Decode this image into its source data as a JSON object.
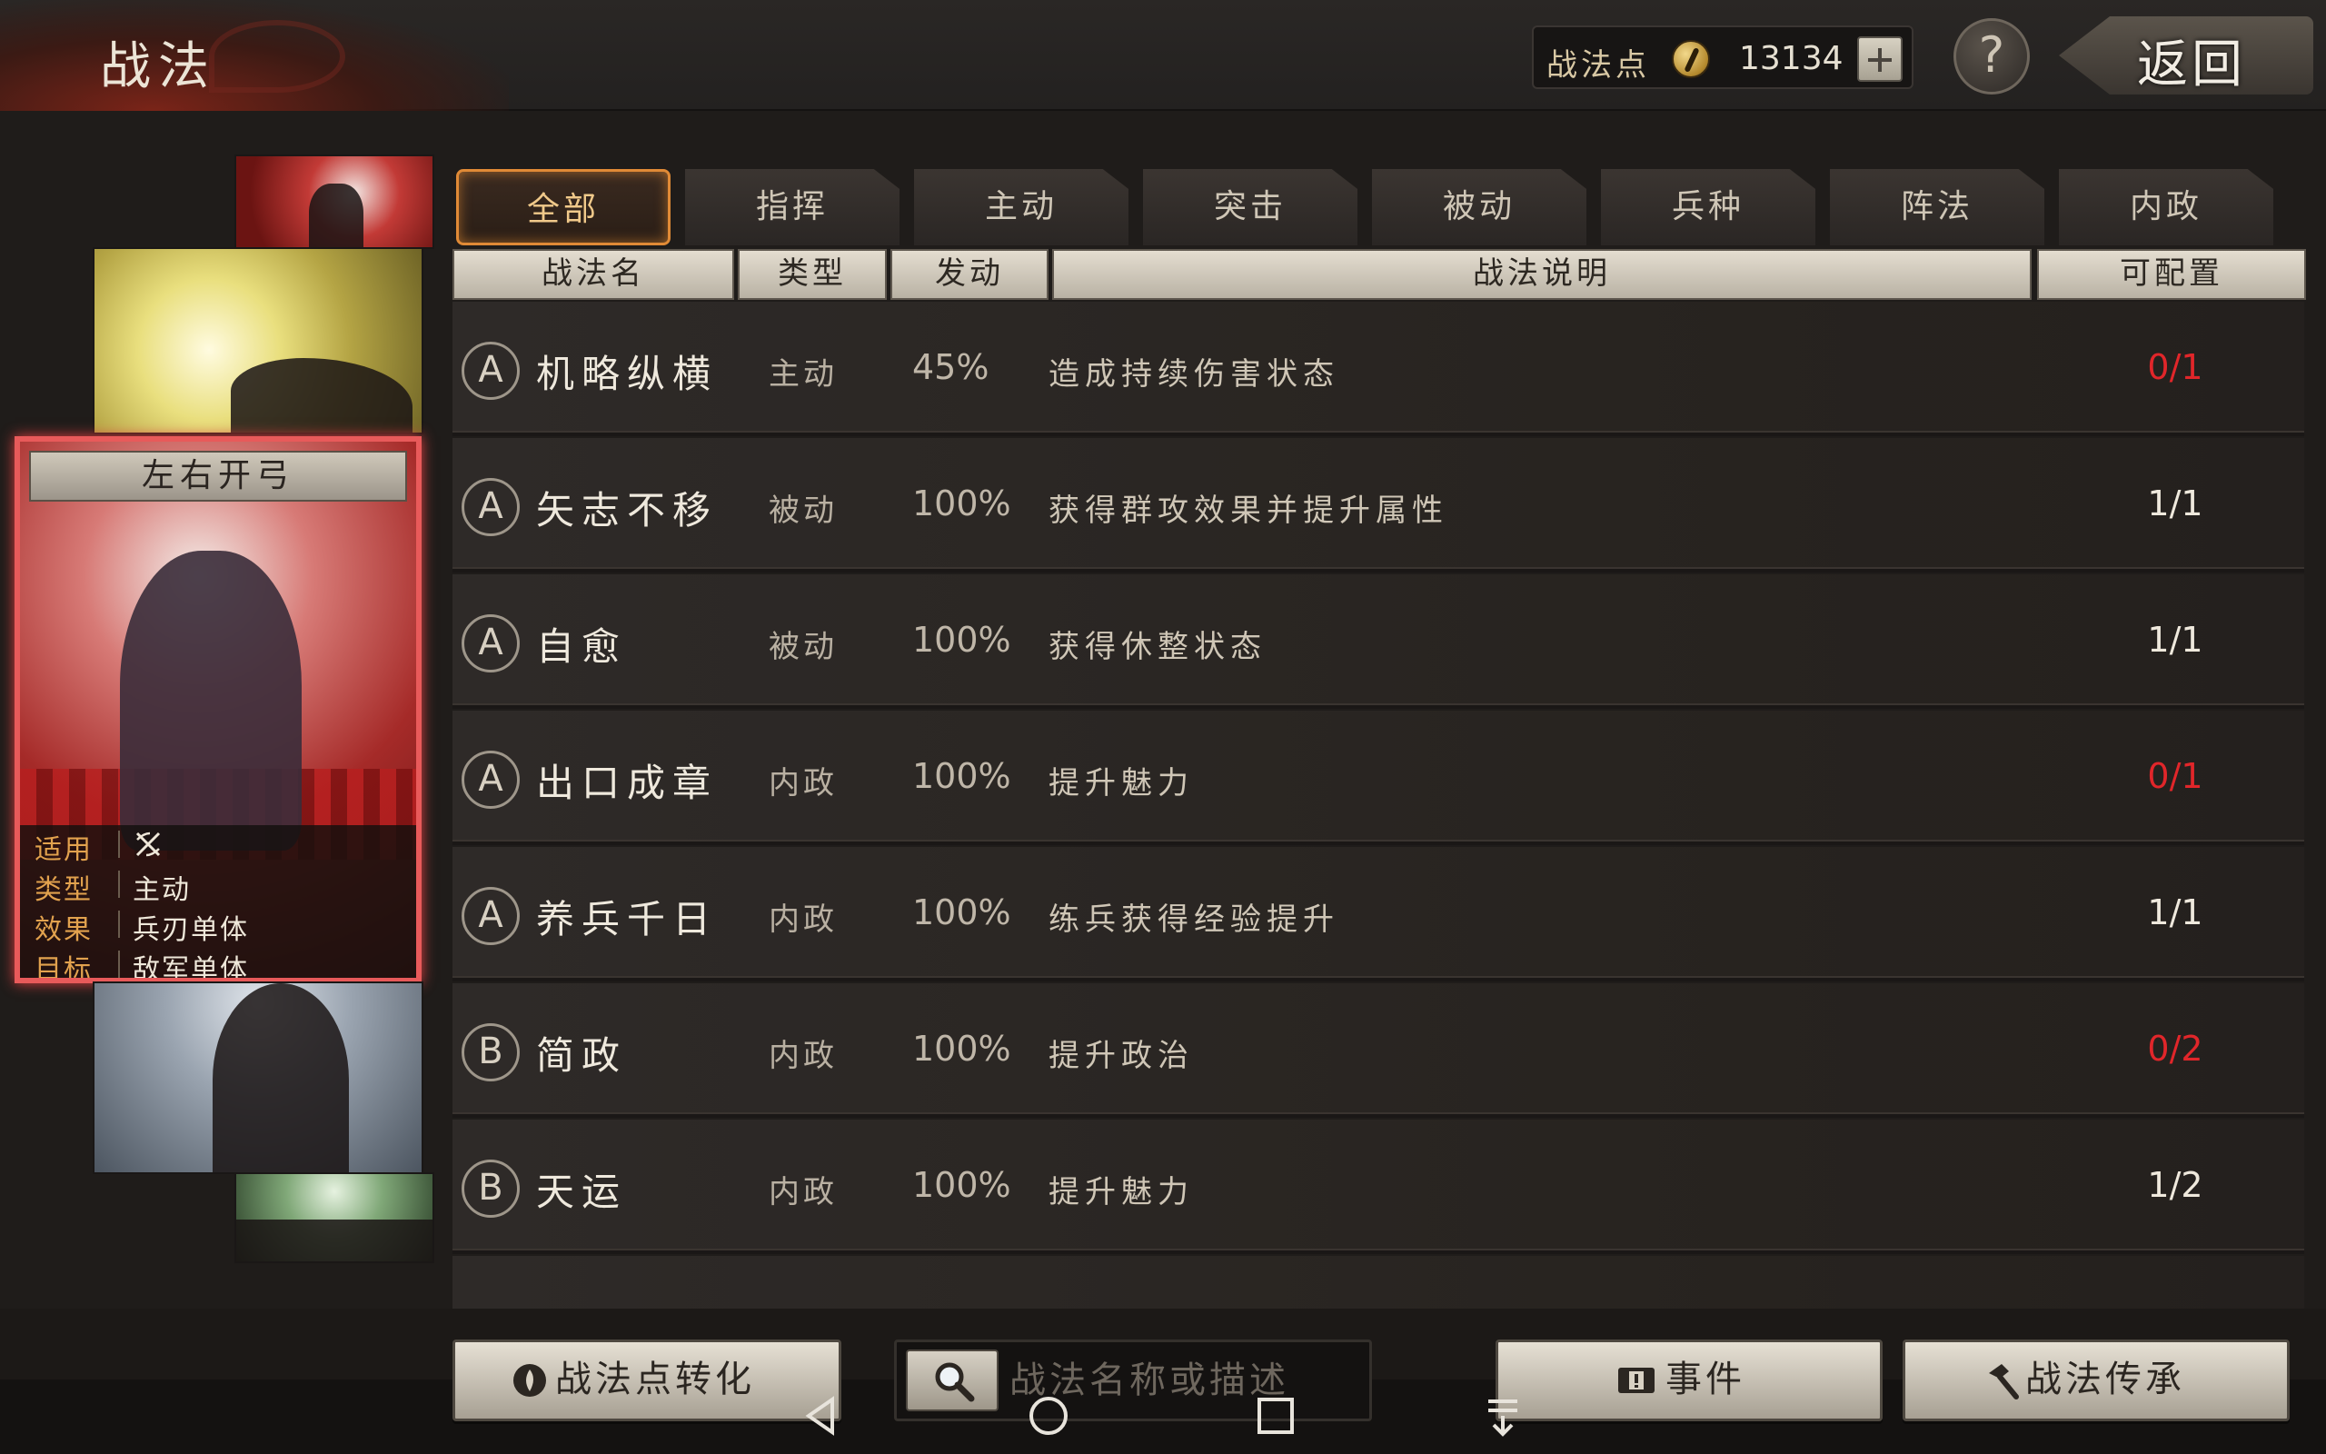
{
  "header": {
    "title": "战法",
    "points_label": "战法点",
    "points_value": "13134",
    "help_label": "?",
    "back_label": "返回"
  },
  "tabs": [
    {
      "label": "全部",
      "active": true
    },
    {
      "label": "指挥",
      "active": false
    },
    {
      "label": "主动",
      "active": false
    },
    {
      "label": "突击",
      "active": false
    },
    {
      "label": "被动",
      "active": false
    },
    {
      "label": "兵种",
      "active": false
    },
    {
      "label": "阵法",
      "active": false
    },
    {
      "label": "内政",
      "active": false
    }
  ],
  "columns": {
    "name": "战法名",
    "type": "类型",
    "trigger": "发动",
    "description": "战法说明",
    "configurable": "可配置"
  },
  "selected_card": {
    "title": "左右开弓",
    "rows": [
      {
        "key": "适用",
        "value": "",
        "icon": "crossed-bows-icon"
      },
      {
        "key": "类型",
        "value": "主动"
      },
      {
        "key": "效果",
        "value": "兵刃单体"
      },
      {
        "key": "目标",
        "value": "敌军单体"
      }
    ]
  },
  "skills": [
    {
      "grade": "A",
      "name": "机略纵横",
      "type": "主动",
      "rate": "45%",
      "desc": "造成持续伤害状态",
      "count": "0/1",
      "red": true
    },
    {
      "grade": "A",
      "name": "矢志不移",
      "type": "被动",
      "rate": "100%",
      "desc": "获得群攻效果并提升属性",
      "count": "1/1",
      "red": false
    },
    {
      "grade": "A",
      "name": "自愈",
      "type": "被动",
      "rate": "100%",
      "desc": "获得休整状态",
      "count": "1/1",
      "red": false
    },
    {
      "grade": "A",
      "name": "出口成章",
      "type": "内政",
      "rate": "100%",
      "desc": "提升魅力",
      "count": "0/1",
      "red": true
    },
    {
      "grade": "A",
      "name": "养兵千日",
      "type": "内政",
      "rate": "100%",
      "desc": "练兵获得经验提升",
      "count": "1/1",
      "red": false
    },
    {
      "grade": "B",
      "name": "简政",
      "type": "内政",
      "rate": "100%",
      "desc": "提升政治",
      "count": "0/2",
      "red": true
    },
    {
      "grade": "B",
      "name": "天运",
      "type": "内政",
      "rate": "100%",
      "desc": "提升魅力",
      "count": "1/2",
      "red": false
    }
  ],
  "footer": {
    "convert_label": "战法点转化",
    "search_placeholder": "战法名称或描述",
    "events_label": "事件",
    "inherit_label": "战法传承"
  },
  "colors": {
    "accent_orange": "#e08a36",
    "count_red": "#e1262a",
    "card_border": "#e85a5a"
  }
}
